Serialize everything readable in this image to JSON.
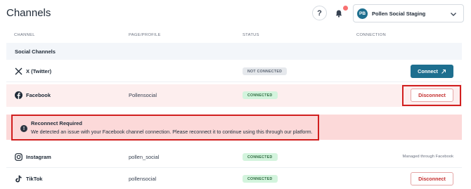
{
  "header": {
    "title": "Channels",
    "help_label": "?",
    "account": {
      "initials": "PB",
      "name": "Pollen Social Staging"
    }
  },
  "table": {
    "columns": [
      "CHANNEL",
      "PAGE/PROFILE",
      "STATUS",
      "CONNECTION"
    ],
    "section_title": "Social Channels",
    "rows": [
      {
        "channel": "X (Twitter)",
        "icon": "x-twitter-icon",
        "profile": "",
        "status": "NOT CONNECTED",
        "action": "Connect"
      },
      {
        "channel": "Facebook",
        "icon": "facebook-icon",
        "profile": "Pollensocial",
        "status": "CONNECTED",
        "action": "Disconnect"
      },
      {
        "channel": "Instagram",
        "icon": "instagram-icon",
        "profile": "pollen_social",
        "status": "CONNECTED",
        "note": "Managed through Facebook"
      },
      {
        "channel": "TikTok",
        "icon": "tiktok-icon",
        "profile": "pollensocial",
        "status": "CONNECTED",
        "action": "Disconnect"
      }
    ]
  },
  "alert": {
    "title": "Reconnect Required",
    "message": "We detected an issue with your Facebook channel connection. Please reconnect it to continue using this through our platform."
  },
  "colors": {
    "primary": "#1e6f8f",
    "danger": "#c53030",
    "highlight": "#d11f1f",
    "alert_bg": "#fcd9d9",
    "connected_bg": "#d3f4dd"
  }
}
